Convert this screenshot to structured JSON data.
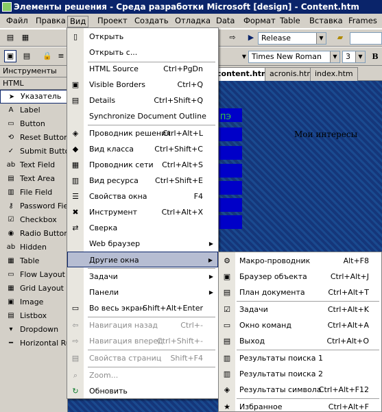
{
  "window": {
    "title": "Элементы решения - Среда разработки Microsoft [design] - Content.htm"
  },
  "menubar": {
    "items": [
      "Файл",
      "Правка",
      "Вид",
      "Проект",
      "Создать",
      "Отладка",
      "Data",
      "Формат",
      "Table",
      "Вставка",
      "Frames"
    ]
  },
  "toolbar": {
    "configuration": "Release",
    "font": "Times New Roman",
    "font_size": "3",
    "bold": "B"
  },
  "toolbox": {
    "title": "Инструменты",
    "group": "HTML",
    "items": [
      "Указатель",
      "Label",
      "Button",
      "Reset Button",
      "Submit Button",
      "Text Field",
      "Text Area",
      "File Field",
      "Password Field",
      "Checkbox",
      "Radio Button",
      "Hidden",
      "Table",
      "Flow Layout Panel",
      "Grid Layout Panel",
      "Image",
      "Listbox",
      "Dropdown",
      "Horizontal Rule"
    ]
  },
  "editor": {
    "tabs": [
      "content.htm",
      "acronis.htm",
      "index.htm"
    ],
    "text_green": "ПЭ",
    "heading": "Мои интересы"
  },
  "view_menu": {
    "items": [
      {
        "label": "Открыть",
        "shortcut": ""
      },
      {
        "label": "Открыть с...",
        "shortcut": ""
      },
      {
        "label": "HTML Source",
        "shortcut": "Ctrl+PgDn"
      },
      {
        "label": "Visible Borders",
        "shortcut": "Ctrl+Q"
      },
      {
        "label": "Details",
        "shortcut": "Ctrl+Shift+Q"
      },
      {
        "label": "Synchronize Document Outline",
        "shortcut": ""
      },
      {
        "label": "Проводник решения",
        "shortcut": "Ctrl+Alt+L"
      },
      {
        "label": "Вид класса",
        "shortcut": "Ctrl+Shift+C"
      },
      {
        "label": "Проводник сети",
        "shortcut": "Ctrl+Alt+S"
      },
      {
        "label": "Вид ресурса",
        "shortcut": "Ctrl+Shift+E"
      },
      {
        "label": "Свойства окна",
        "shortcut": "F4"
      },
      {
        "label": "Инструмент",
        "shortcut": "Ctrl+Alt+X"
      },
      {
        "label": "Сверка",
        "shortcut": ""
      },
      {
        "label": "Web браузер",
        "shortcut": ""
      },
      {
        "label": "Другие окна",
        "shortcut": ""
      },
      {
        "label": "Задачи",
        "shortcut": ""
      },
      {
        "label": "Панели",
        "shortcut": ""
      },
      {
        "label": "Во весь экран",
        "shortcut": "Shift+Alt+Enter"
      },
      {
        "label": "Навигация назад",
        "shortcut": "Ctrl+-"
      },
      {
        "label": "Навигация вперед",
        "shortcut": "Ctrl+Shift+-"
      },
      {
        "label": "Свойства страниц",
        "shortcut": "Shift+F4"
      },
      {
        "label": "Zoom...",
        "shortcut": ""
      },
      {
        "label": "Обновить",
        "shortcut": ""
      }
    ]
  },
  "other_windows_menu": {
    "items": [
      {
        "label": "Макро-проводник",
        "shortcut": "Alt+F8"
      },
      {
        "label": "Браузер объекта",
        "shortcut": "Ctrl+Alt+J"
      },
      {
        "label": "План документа",
        "shortcut": "Ctrl+Alt+T"
      },
      {
        "label": "Задачи",
        "shortcut": "Ctrl+Alt+K"
      },
      {
        "label": "Окно команд",
        "shortcut": "Ctrl+Alt+A"
      },
      {
        "label": "Выход",
        "shortcut": "Ctrl+Alt+O"
      },
      {
        "label": "Результаты поиска 1",
        "shortcut": ""
      },
      {
        "label": "Результаты поиска 2",
        "shortcut": ""
      },
      {
        "label": "Результаты символа",
        "shortcut": "Ctrl+Alt+F12"
      },
      {
        "label": "Избранное",
        "shortcut": "Ctrl+Alt+F"
      }
    ]
  }
}
